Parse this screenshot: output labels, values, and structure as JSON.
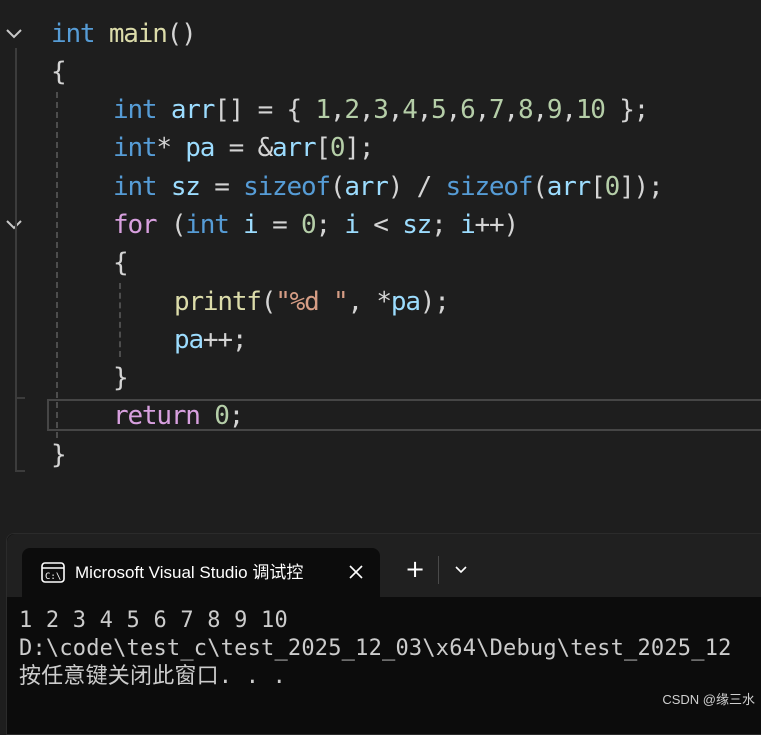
{
  "editor": {
    "code": {
      "l1": {
        "kw": "int",
        "fn": "main",
        "p": "()"
      },
      "l2": {
        "p": "{"
      },
      "l3": {
        "kw": "int",
        "var": "arr",
        "p1": "[] = { ",
        "n1": "1",
        "c1": ",",
        "n2": "2",
        "c2": ",",
        "n3": "3",
        "c3": ",",
        "n4": "4",
        "c4": ",",
        "n5": "5",
        "c5": ",",
        "n6": "6",
        "c6": ",",
        "n7": "7",
        "c7": ",",
        "n8": "8",
        "c8": ",",
        "n9": "9",
        "c9": ",",
        "n10": "10",
        "p2": " };"
      },
      "l4": {
        "kw": "int",
        "p1": "* ",
        "var1": "pa",
        "p2": " = &",
        "var2": "arr",
        "p3": "[",
        "num": "0",
        "p4": "];"
      },
      "l5": {
        "kw": "int",
        "var1": "sz",
        "p1": " = ",
        "kw2": "sizeof",
        "p2": "(",
        "var2": "arr",
        "p3": ") / ",
        "kw3": "sizeof",
        "p4": "(",
        "var3": "arr",
        "p5": "[",
        "num": "0",
        "p6": "]);"
      },
      "l6": {
        "ctrl": "for",
        "p1": " (",
        "kw": "int",
        "var1": "i",
        "p2": " = ",
        "n1": "0",
        "p3": "; ",
        "var2": "i",
        "p4": " < ",
        "var3": "sz",
        "p5": "; ",
        "var4": "i",
        "p6": "++)"
      },
      "l7": {
        "p": "{"
      },
      "l8": {
        "fn": "printf",
        "p1": "(",
        "str": "\"%d \"",
        "p2": ", *",
        "var": "pa",
        "p3": ");"
      },
      "l9": {
        "var": "pa",
        "p": "++;"
      },
      "l10": {
        "p": "}"
      },
      "l11": {
        "ctrl": "return",
        "num": "0",
        "p": ";"
      },
      "l12": {
        "p": "}"
      }
    }
  },
  "console": {
    "tab_title": "Microsoft Visual Studio 调试控",
    "new_tab_label": "+",
    "lines": [
      "1 2 3 4 5 6 7 8 9 10",
      "D:\\code\\test_c\\test_2025_12_03\\x64\\Debug\\test_2025_12",
      "按任意键关闭此窗口. . ."
    ]
  },
  "watermark": "CSDN @缘三水",
  "icons": [
    "fold-chevron-icon",
    "terminal-icon",
    "close-icon",
    "chevron-down-icon"
  ],
  "colors": {
    "editor_bg": "#1e1e1e",
    "keyword": "#569cd6",
    "control": "#d8a0df",
    "function": "#dcdcaa",
    "variable": "#9cdcfe",
    "number": "#b5cea8",
    "string": "#d69d85",
    "console_bg": "#0c0c0c",
    "titlebar_bg": "#202020"
  }
}
